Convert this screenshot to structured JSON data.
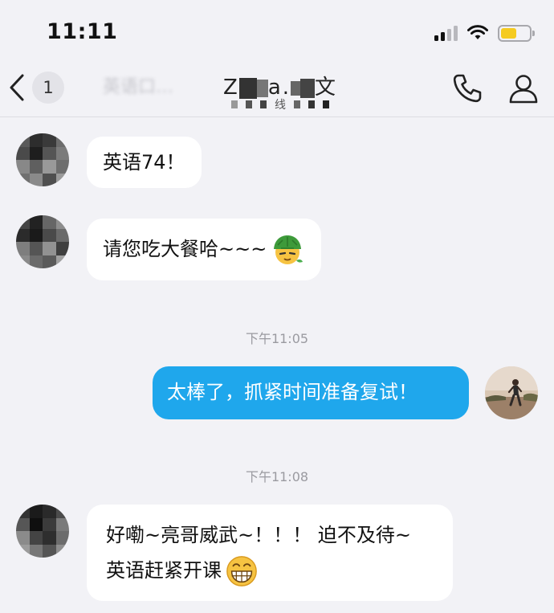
{
  "status_bar": {
    "time": "11:11"
  },
  "nav": {
    "back_count": "1",
    "title_blurred": "英语口…",
    "title_visible_a": "Z",
    "title_visible_b": "a.",
    "title_visible_c": "文",
    "subtitle_visible": "线",
    "icons": [
      "back-chevron-icon",
      "phone-icon",
      "person-icon"
    ]
  },
  "messages": [
    {
      "side": "left",
      "text": "英语74！"
    },
    {
      "side": "left",
      "text": "请您吃大餐哈~~~",
      "emoji": "turtle-emoji-icon"
    },
    {
      "type": "time",
      "text": "下午11:05"
    },
    {
      "side": "right",
      "text": "太棒了，抓紧时间准备复试！"
    },
    {
      "type": "time",
      "text": "下午11:08"
    },
    {
      "side": "left",
      "line1": "好嘞~亮哥威武~！！！ 迫不及待~",
      "line2": "英语赶紧开课",
      "emoji": "grin-emoji-icon"
    }
  ],
  "colors": {
    "background": "#f2f2f6",
    "my_bubble": "#1fa7ec",
    "other_bubble": "#ffffff",
    "battery": "#f5cb20"
  }
}
